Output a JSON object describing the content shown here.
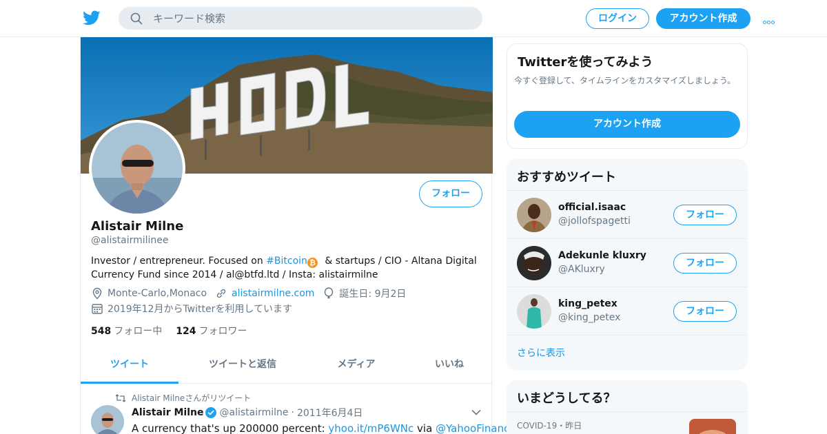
{
  "header": {
    "search_placeholder": "キーワード検索",
    "login_label": "ログイン",
    "signup_label": "アカウント作成"
  },
  "profile": {
    "name": "Alistair Milne",
    "handle": "@alistairmilinee",
    "follow_label": "フォロー",
    "banner_text": "HODL",
    "bio_before": "Investor / entrepreneur. Focused on ",
    "bio_hashtag": "#Bitcoin",
    "bio_btc_symbol": "₿",
    "bio_after": " & startups / CIO - Altana Digital Currency Fund since 2014 / al@btfd.ltd / Insta: alistairmilne",
    "location": "Monte-Carlo,Monaco",
    "website": "alistairmilne.com",
    "birthday": "誕生日: 9月2日",
    "joined": "2019年12月からTwitterを利用しています",
    "following_count": "548",
    "following_label": "フォロー中",
    "followers_count": "124",
    "followers_label": "フォロワー"
  },
  "tabs": [
    {
      "label": "ツイート",
      "active": true
    },
    {
      "label": "ツイートと返信",
      "active": false
    },
    {
      "label": "メディア",
      "active": false
    },
    {
      "label": "いいね",
      "active": false
    }
  ],
  "tweet": {
    "retweet_text": "Alistair Milneさんがリツイート",
    "name": "Alistair Milne",
    "handle": "@alistairmilne",
    "date": "2011年6月4日",
    "text_before": "A currency that's up 200000 percent: ",
    "link": "yhoo.it/mP6WNc",
    "text_mid": " via ",
    "mention": "@YahooFinance"
  },
  "signup_card": {
    "title": "Twitterを使ってみよう",
    "description": "今すぐ登録して、タイムラインをカスタマイズしましょう。",
    "button_label": "アカウント作成"
  },
  "who_to_follow": {
    "title": "おすすめツイート",
    "follow_label": "フォロー",
    "users": [
      {
        "name": "official.isaac",
        "handle": "@jollofspagetti"
      },
      {
        "name": "Adekunle kluxry",
        "handle": "@AKluxry"
      },
      {
        "name": "king_petex",
        "handle": "@king_petex"
      }
    ],
    "show_more": "さらに表示"
  },
  "trends": {
    "title": "いまどうしてる？",
    "category": "COVID-19・昨日"
  },
  "colors": {
    "accent": "#1da1f2",
    "link": "#1b95e0",
    "text_secondary": "#657786",
    "border": "#e6ecf0",
    "panel_bg": "#f5f8fa"
  }
}
